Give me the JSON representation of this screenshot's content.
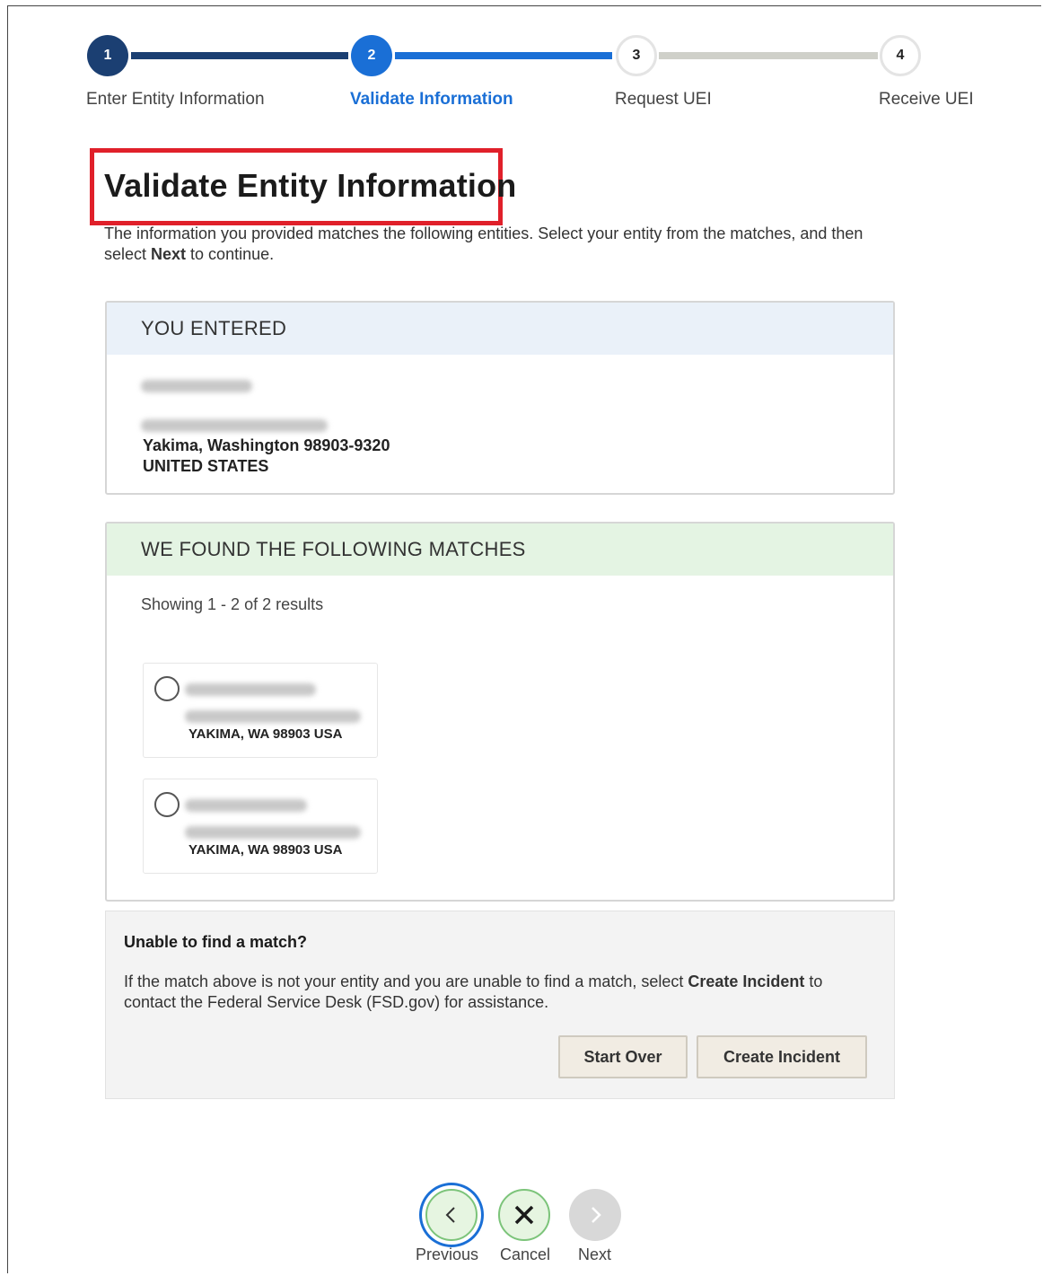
{
  "stepper": {
    "steps": [
      {
        "number": "1",
        "label": "Enter Entity Information",
        "state": "complete"
      },
      {
        "number": "2",
        "label": "Validate Information",
        "state": "active"
      },
      {
        "number": "3",
        "label": "Request UEI",
        "state": "upcoming"
      },
      {
        "number": "4",
        "label": "Receive UEI",
        "state": "upcoming"
      }
    ]
  },
  "page": {
    "title": "Validate Entity Information",
    "intro_part1": "The information you provided matches the following entities. Select your entity from the matches, and then select ",
    "intro_bold": "Next",
    "intro_part2": " to continue."
  },
  "entered": {
    "heading": "YOU ENTERED",
    "city_line": "Yakima, Washington 98903-9320",
    "country": "UNITED STATES"
  },
  "matches": {
    "heading": "WE FOUND THE FOLLOWING MATCHES",
    "showing": "Showing 1 - 2 of 2 results",
    "items": [
      {
        "city": "YAKIMA, WA 98903 USA"
      },
      {
        "city": "YAKIMA, WA 98903 USA"
      }
    ]
  },
  "unable": {
    "title": "Unable to find a match?",
    "text_part1": "If the match above is not your entity and you are unable to find a match, select ",
    "text_bold": "Create Incident",
    "text_part2": " to contact the Federal Service Desk (FSD.gov) for assistance.",
    "start_over": "Start Over",
    "create_incident": "Create Incident"
  },
  "nav": {
    "previous": "Previous",
    "cancel": "Cancel",
    "next": "Next"
  },
  "colors": {
    "step_complete": "#1b3f72",
    "step_active": "#1a6fd6",
    "step_upcoming_line": "#cfd0c9",
    "highlight": "#e0202a",
    "entered_header": "#eaf1f9",
    "matches_header": "#e4f4e3",
    "nav_green_bg": "#e6f5e1",
    "nav_green_border": "#7cc47a"
  }
}
